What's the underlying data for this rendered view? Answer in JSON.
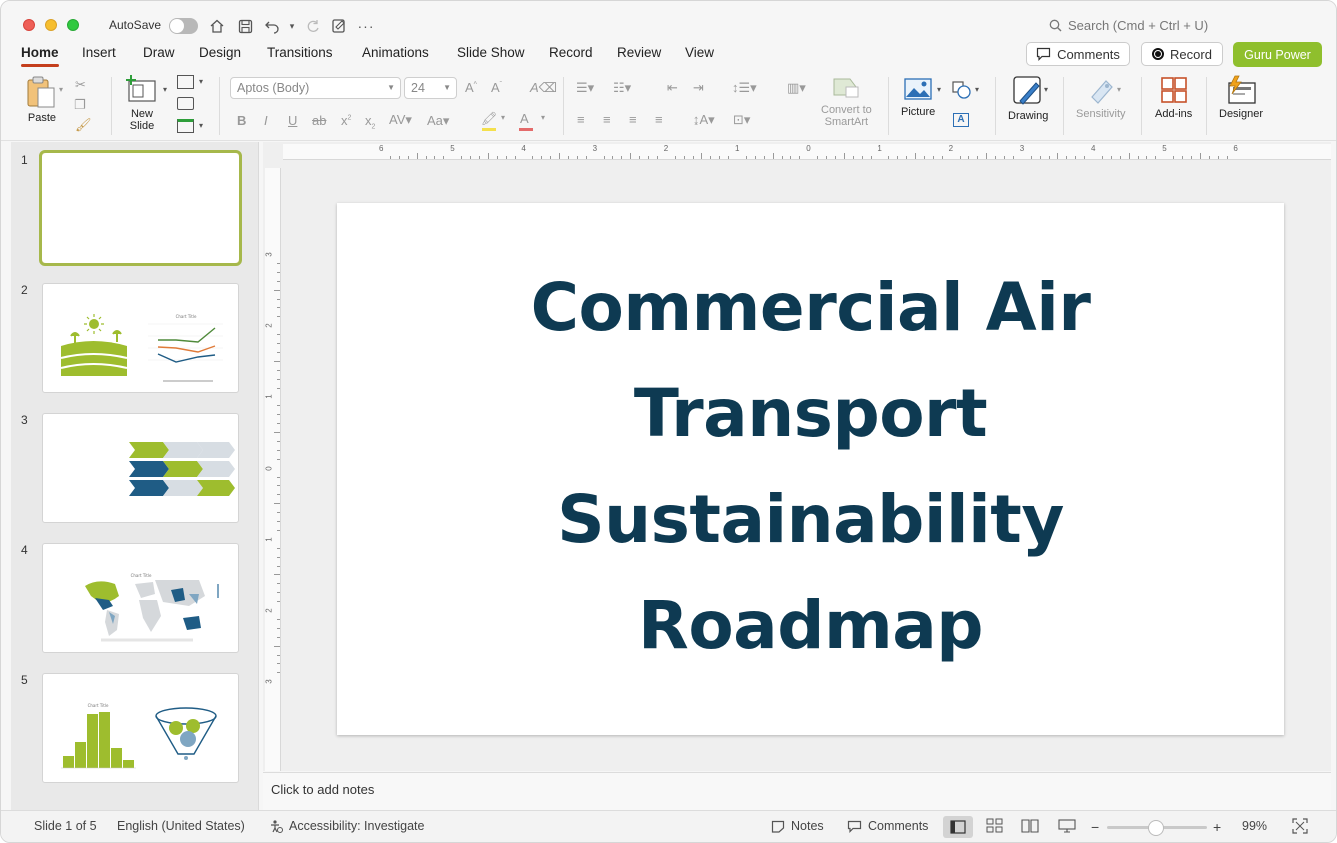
{
  "titlebar": {
    "autosave_label": "AutoSave",
    "search_placeholder": "Search (Cmd + Ctrl + U)"
  },
  "tabs": [
    "Home",
    "Insert",
    "Draw",
    "Design",
    "Transitions",
    "Animations",
    "Slide Show",
    "Record",
    "Review",
    "View"
  ],
  "actions": {
    "comments": "Comments",
    "record": "Record",
    "guru": "Guru Power"
  },
  "ribbon": {
    "paste": "Paste",
    "new_slide_line1": "New",
    "new_slide_line2": "Slide",
    "font_name": "Aptos (Body)",
    "font_size": "24",
    "convert_line1": "Convert to",
    "convert_line2": "SmartArt",
    "picture": "Picture",
    "drawing": "Drawing",
    "sensitivity": "Sensitivity",
    "addins": "Add-ins",
    "designer": "Designer"
  },
  "ruler": {
    "h_labels": [
      "6",
      "5",
      "4",
      "3",
      "2",
      "1",
      "0",
      "1",
      "2",
      "3",
      "4",
      "5",
      "6"
    ],
    "v_labels": [
      "3",
      "2",
      "1",
      "0",
      "1",
      "2",
      "3"
    ]
  },
  "slides": [
    {
      "num": "1"
    },
    {
      "num": "2",
      "chart_title": "Chart Title"
    },
    {
      "num": "3"
    },
    {
      "num": "4",
      "chart_title": "Chart Title"
    },
    {
      "num": "5",
      "chart_title": "Chart Title"
    }
  ],
  "slide": {
    "title_lines": [
      "Commercial Air",
      "Transport",
      "Sustainability",
      "Roadmap"
    ]
  },
  "notes": {
    "placeholder": "Click to add notes"
  },
  "status": {
    "slide_count": "Slide 1 of 5",
    "language": "English (United States)",
    "accessibility": "Accessibility: Investigate",
    "notes": "Notes",
    "comments": "Comments",
    "zoom": "99%"
  },
  "colors": {
    "accent_green": "#8fbf2d",
    "title_navy": "#0e3a52",
    "tab_underline": "#c43e1c"
  }
}
